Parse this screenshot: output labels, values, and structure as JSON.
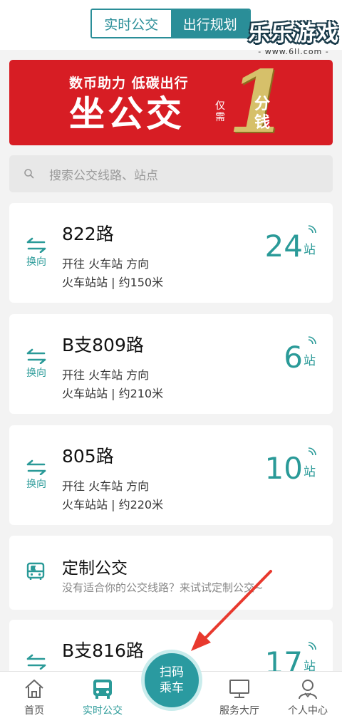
{
  "header": {
    "tabs": [
      {
        "label": "实时公交",
        "active": true
      },
      {
        "label": "出行规划",
        "active": false
      }
    ],
    "accent_color": "#2a8e98"
  },
  "watermark": {
    "title": "乐乐游戏",
    "url": "- www.6ll.com -"
  },
  "banner": {
    "top_line": "数币助力 低碳出行",
    "main_text": "坐公交",
    "only_text": "仅需",
    "amount": "1",
    "unit_text": "分钱",
    "background_color": "#d71d24"
  },
  "search": {
    "placeholder": "搜索公交线路、站点",
    "icon": "search-icon"
  },
  "routes": [
    {
      "name": "822路",
      "direction": "开往 火车站 方向",
      "stop_info": "火车站站 | 约150米",
      "swap_label": "换向",
      "stops": "24",
      "stops_unit": "站"
    },
    {
      "name": "B支809路",
      "direction": "开往 火车站 方向",
      "stop_info": "火车站站 | 约210米",
      "swap_label": "换向",
      "stops": "6",
      "stops_unit": "站"
    },
    {
      "name": "805路",
      "direction": "开往 火车站 方向",
      "stop_info": "火车站站 | 约220米",
      "swap_label": "换向",
      "stops": "10",
      "stops_unit": "站"
    },
    {
      "name": "B支816路",
      "direction": "",
      "stop_info": "",
      "swap_label": "",
      "stops": "17",
      "stops_unit": "站"
    }
  ],
  "custom_bus": {
    "title": "定制公交",
    "subtitle": "没有适合你的公交线路？来试试定制公交~",
    "icon": "custom-bus-icon"
  },
  "tabbar": {
    "items": [
      {
        "label": "首页",
        "icon": "home-icon",
        "active": false
      },
      {
        "label": "实时公交",
        "icon": "bus-icon",
        "active": true
      },
      {
        "label": "服务大厅",
        "icon": "monitor-icon",
        "active": false
      },
      {
        "label": "个人中心",
        "icon": "person-icon",
        "active": false
      }
    ],
    "scan_button": {
      "line1": "扫码",
      "line2": "乘车"
    }
  },
  "colors": {
    "accent": "#2a9a98",
    "annotation_arrow": "#e8392e"
  }
}
